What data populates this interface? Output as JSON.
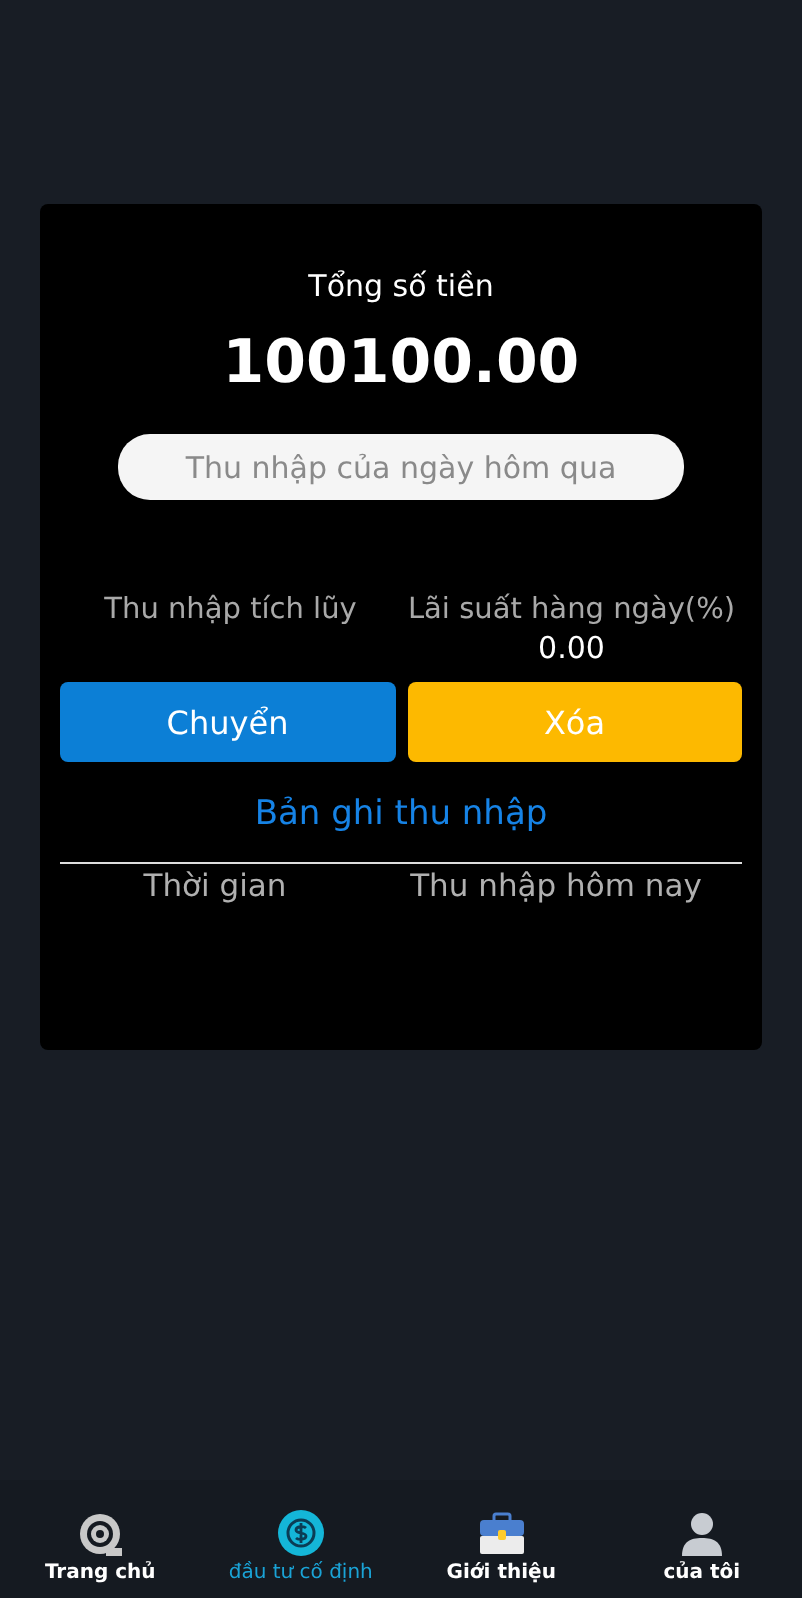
{
  "summary": {
    "title": "Tổng số tiền",
    "amount": "100100.00",
    "yesterday": {
      "placeholder": "Thu nhập của ngày hôm qua"
    }
  },
  "stats": [
    {
      "label": "Thu nhập tích lũy"
    },
    {
      "label": "Lãi suất hàng ngày(%)",
      "value": "0.00"
    }
  ],
  "actions": [
    {
      "label": "Chuyển",
      "kind": "primary"
    },
    {
      "label": "Xóa",
      "kind": "warning"
    }
  ],
  "records": {
    "link": "Bản ghi thu nhập",
    "columns": [
      "Thời gian",
      "Thu nhập hôm nay"
    ]
  },
  "tab_bar": [
    {
      "label": "Trang chủ",
      "kind": "home",
      "selected": false
    },
    {
      "label": "đầu tư cố định",
      "kind": "invest",
      "selected": true
    },
    {
      "label": "Giới thiệu",
      "kind": "intro",
      "selected": false
    },
    {
      "label": "của tôi",
      "kind": "user",
      "selected": false
    }
  ]
}
